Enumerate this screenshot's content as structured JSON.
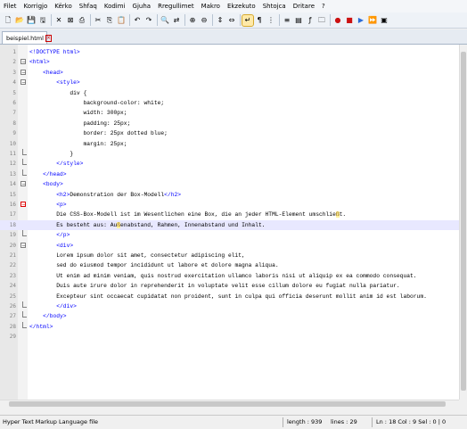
{
  "menu": [
    "Filet",
    "Korrigjo",
    "Kërko",
    "Shfaq",
    "Kodimi",
    "Gjuha",
    "Rregullimet",
    "Makro",
    "Ekzekuto",
    "Shtojca",
    "Dritare",
    "?"
  ],
  "toolbar_icons": [
    "new-file-icon",
    "open-folder-icon",
    "save-icon",
    "save-all-icon",
    "close-icon",
    "close-all-icon",
    "print-icon",
    "cut-icon",
    "copy-icon",
    "paste-icon",
    "undo-icon",
    "redo-icon",
    "find-icon",
    "replace-icon",
    "zoom-in-icon",
    "zoom-out-icon",
    "sync-vertical-icon",
    "sync-horizontal-icon",
    "word-wrap-icon",
    "show-all-chars-icon",
    "indent-guide-icon",
    "language-icon",
    "doc-map-icon",
    "function-list-icon",
    "folder-workspace-icon",
    "record-macro-icon",
    "stop-macro-icon",
    "play-macro-icon",
    "run-macro-multiple-icon",
    "save-macro-icon"
  ],
  "tab": {
    "label": "beispiel.html"
  },
  "editor": {
    "current_line": 18,
    "lines": [
      {
        "n": "1",
        "text": "<!DOCTYPE html>"
      },
      {
        "n": "2",
        "text": "<html>"
      },
      {
        "n": "3",
        "text": "    <head>"
      },
      {
        "n": "4",
        "text": "        <style>"
      },
      {
        "n": "5",
        "text": "            div {"
      },
      {
        "n": "6",
        "text": "                background-color: white;"
      },
      {
        "n": "7",
        "text": "                width: 300px;"
      },
      {
        "n": "8",
        "text": "                padding: 25px;"
      },
      {
        "n": "9",
        "text": "                border: 25px dotted blue;"
      },
      {
        "n": "10",
        "text": "                margin: 25px;"
      },
      {
        "n": "11",
        "text": "            }"
      },
      {
        "n": "12",
        "text": "        </style>"
      },
      {
        "n": "13",
        "text": "    </head>"
      },
      {
        "n": "14",
        "text": "    <body>"
      },
      {
        "n": "15",
        "text": "        <h2>Demonstration der Box-Modell</h2>"
      },
      {
        "n": "16",
        "text": "        <p>"
      },
      {
        "n": "17",
        "text": "        Die CSS-Box-Modell ist im Wesentlichen eine Box, die an jeder HTML-Element umschließt."
      },
      {
        "n": "18",
        "text": "        Es besteht aus: Außenabstand, Rahmen, Innenabstand und Inhalt."
      },
      {
        "n": "19",
        "text": "        </p>"
      },
      {
        "n": "20",
        "text": "        <div>"
      },
      {
        "n": "21",
        "text": "        Lorem ipsum dolor sit amet, consectetur adipiscing elit,"
      },
      {
        "n": "22",
        "text": "        sed do eiusmod tempor incididunt ut labore et dolore magna aliqua."
      },
      {
        "n": "23",
        "text": "        Ut enim ad minim veniam, quis nostrud exercitation ullamco laboris nisi ut aliquip ex ea commodo consequat."
      },
      {
        "n": "24",
        "text": "        Duis aute irure dolor in reprehenderit in voluptate velit esse cillum dolore eu fugiat nulla pariatur."
      },
      {
        "n": "25",
        "text": "        Excepteur sint occaecat cupidatat non proident, sunt in culpa qui officia deserunt mollit anim id est laborum."
      },
      {
        "n": "26",
        "text": "        </div>"
      },
      {
        "n": "27",
        "text": "    </body>"
      },
      {
        "n": "28",
        "text": "</html>"
      },
      {
        "n": "29",
        "text": ""
      }
    ]
  },
  "status": {
    "file_type": "Hyper Text Markup Language file",
    "length": "length : 939",
    "lines": "lines : 29",
    "position": "Ln : 18   Col : 9   Sel : 0 | 0"
  },
  "colors": {
    "tag": "#0000ff",
    "current_line": "#e8e8ff"
  }
}
